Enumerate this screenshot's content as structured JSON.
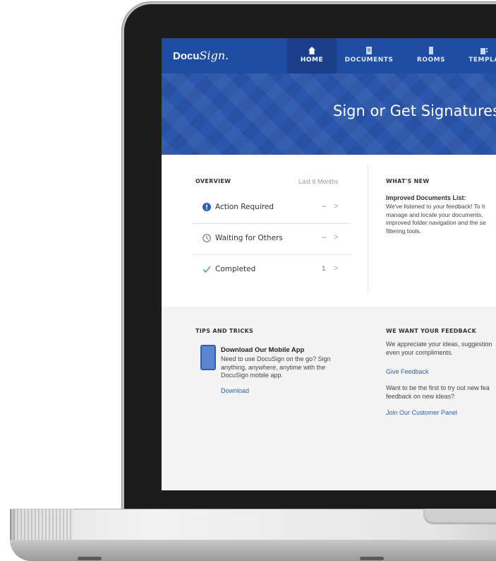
{
  "brand": {
    "logo_text": "Docu",
    "logo_script": "Sign."
  },
  "nav": {
    "home": "HOME",
    "documents": "DOCUMENTS",
    "rooms": "ROOMS",
    "templates": "TEMPLA"
  },
  "hero": {
    "title": "Sign or Get Signatures"
  },
  "overview": {
    "title": "OVERVIEW",
    "range": "Last 6 Months",
    "items": [
      {
        "label": "Action Required",
        "count": "--",
        "icon": "alert-icon"
      },
      {
        "label": "Waiting for Others",
        "count": "--",
        "icon": "clock-icon"
      },
      {
        "label": "Completed",
        "count": "1",
        "icon": "check-icon"
      }
    ]
  },
  "whats_new": {
    "title": "WHAT'S NEW",
    "item_title": "Improved Documents List:",
    "item_body": "We've listened to your feedback! To h\nmanage and locate your documents,\nimproved folder navigation and the se\nfiltering tools."
  },
  "tips": {
    "title": "TIPS AND TRICKS",
    "item_title": "Download Our Mobile App",
    "item_body": "Need to use DocuSign on the go? Sign anything, anywhere, anytime with the DocuSign mobile app.",
    "link": "Download"
  },
  "feedback": {
    "title": "WE WANT YOUR FEEDBACK",
    "text1": "We appreciate your ideas, suggestion even your compliments.",
    "link1": "Give Feedback",
    "text2": "Want to be the first to try out new fea feedback on new ideas?",
    "link2": "Join Our Customer Panel"
  },
  "colors": {
    "brand_blue": "#1e4ca1",
    "link_blue": "#2d5fb5",
    "success_green": "#4caf50"
  }
}
